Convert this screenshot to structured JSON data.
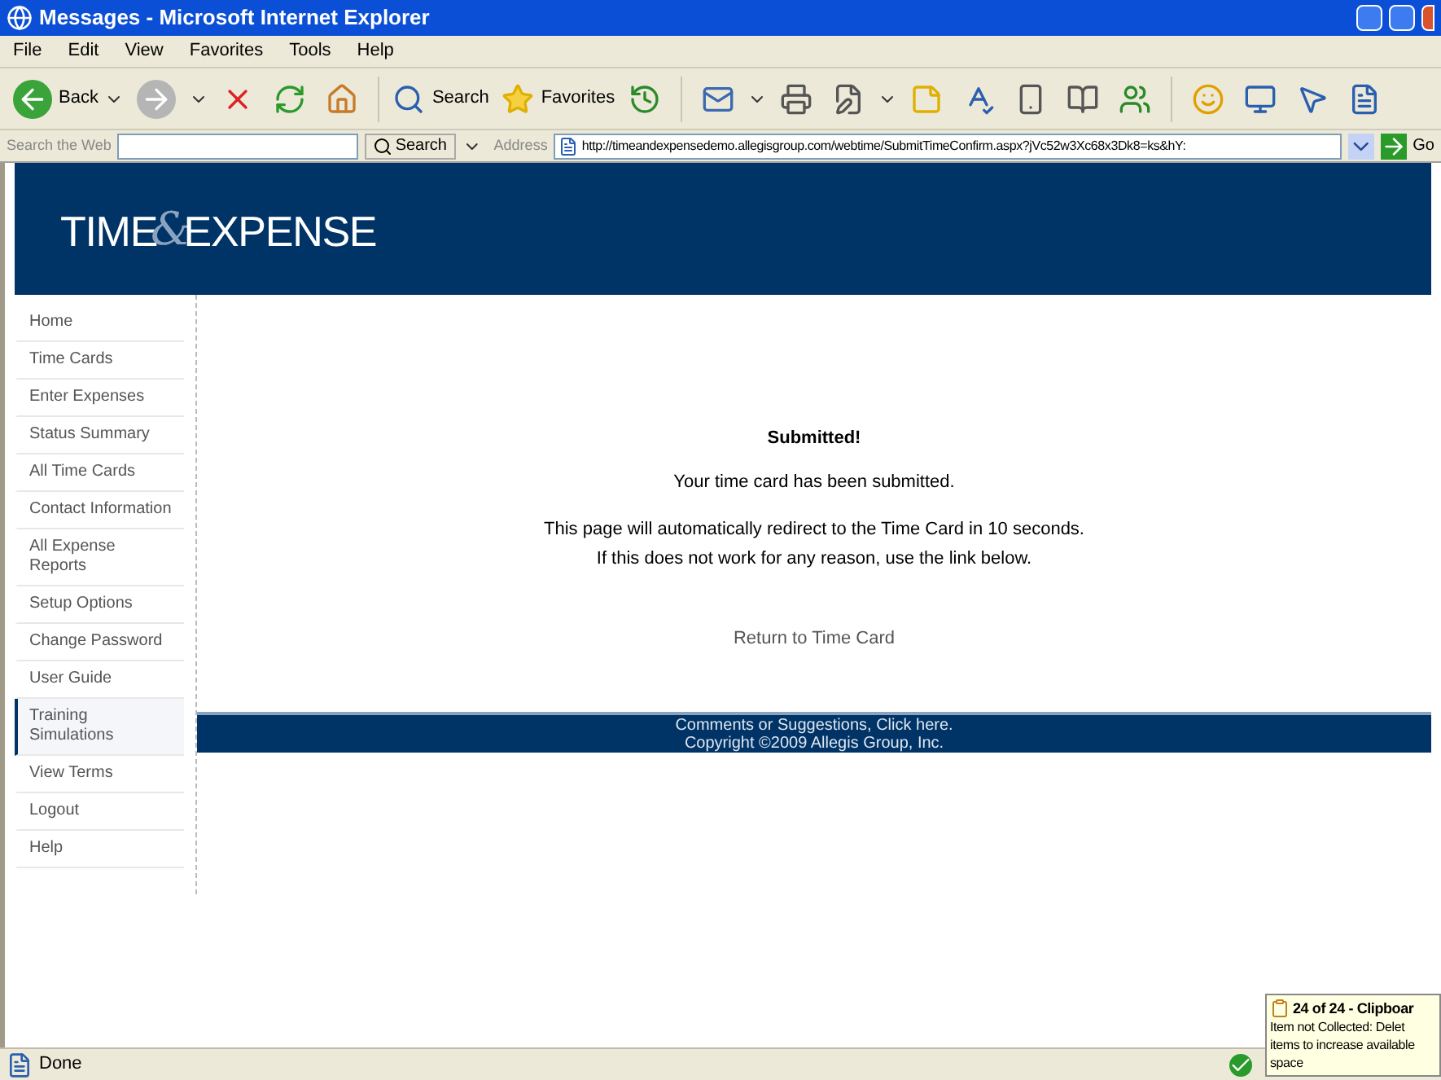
{
  "window": {
    "title": "Messages - Microsoft Internet Explorer"
  },
  "menu": [
    "File",
    "Edit",
    "View",
    "Favorites",
    "Tools",
    "Help"
  ],
  "toolbar": {
    "back": "Back",
    "search": "Search",
    "favorites": "Favorites"
  },
  "search_bar": {
    "label": "Search the Web",
    "button": "Search"
  },
  "address_bar": {
    "label": "Address",
    "url": "http://timeandexpensedemo.allegisgroup.com/webtime/SubmitTimeConfirm.aspx?jVc52w3Xc68x3Dk8=ks&hY:",
    "go": "Go"
  },
  "logo": {
    "first": "TIME",
    "amp": "&",
    "second": "EXPENSE"
  },
  "nav": [
    {
      "label": "Home",
      "selected": false
    },
    {
      "label": "Time Cards",
      "selected": false
    },
    {
      "label": "Enter Expenses",
      "selected": false
    },
    {
      "label": "Status Summary",
      "selected": false
    },
    {
      "label": "All Time Cards",
      "selected": false
    },
    {
      "label": "Contact Information",
      "selected": false
    },
    {
      "label": "All Expense Reports",
      "selected": false
    },
    {
      "label": "Setup Options",
      "selected": false
    },
    {
      "label": "Change Password",
      "selected": false
    },
    {
      "label": "User Guide",
      "selected": false
    },
    {
      "label": "Training Simulations",
      "selected": true
    },
    {
      "label": "View Terms",
      "selected": false
    },
    {
      "label": "Logout",
      "selected": false
    },
    {
      "label": "Help",
      "selected": false
    }
  ],
  "content": {
    "heading": "Submitted!",
    "message": "Your time card has been submitted.",
    "redirect_lines": [
      "This page will automatically redirect to the Time Card in 10 seconds.",
      "If this does not work for any reason, use the link below."
    ],
    "link": "Return to Time Card"
  },
  "footer": {
    "link": "Comments or Suggestions, Click here.",
    "copyright": "Copyright ©2009 Allegis Group, Inc."
  },
  "balloon": {
    "title": "24 of 24 - Clipboar",
    "lines": [
      "Item not Collected: Delet",
      "items to increase available",
      "space"
    ]
  },
  "status_bar": {
    "text": "Done"
  }
}
